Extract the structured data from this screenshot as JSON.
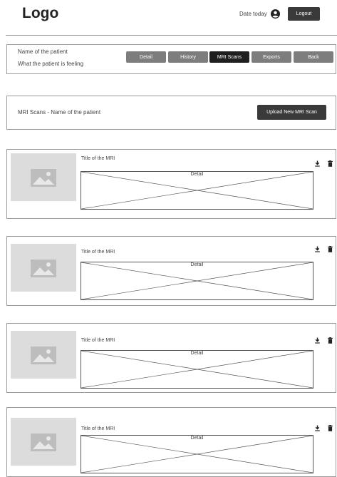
{
  "header": {
    "logo": "Logo",
    "date_text": "Date today",
    "user_icon": "user-circle-icon",
    "logout_label": "Logout"
  },
  "patient": {
    "name": "Name of the patient",
    "feeling": "What the patient is feeling",
    "tabs": [
      {
        "label": "Detail",
        "active": false
      },
      {
        "label": "History",
        "active": false
      },
      {
        "label": "MRI Scans",
        "active": true
      },
      {
        "label": "Exports",
        "active": false
      },
      {
        "label": "Back",
        "active": false
      }
    ]
  },
  "scans": {
    "heading": "MRI Scans - Name of the patient",
    "upload_label": "Upload New MRI Scan"
  },
  "mri_cards": [
    {
      "title": "Title of the MRI",
      "detail_label": "Detail"
    },
    {
      "title": "Title of the MRI",
      "detail_label": "Detail"
    },
    {
      "title": "Title of the MRI",
      "detail_label": "Detail"
    },
    {
      "title": "Title of the MRI",
      "detail_label": "Detail"
    }
  ],
  "icons": {
    "download": "download-icon",
    "delete": "trash-icon",
    "image_placeholder": "image-placeholder-icon"
  },
  "colors": {
    "dark_button": "#3a3a3a",
    "tab_inactive": "#7d7d7d",
    "tab_active": "#1f1f1f",
    "placeholder": "#dcdcdc"
  }
}
